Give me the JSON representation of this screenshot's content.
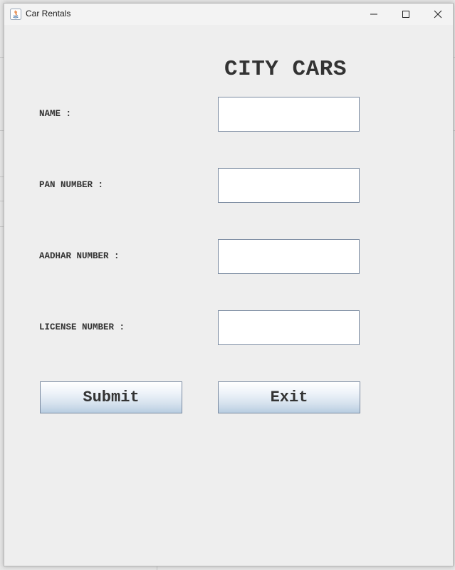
{
  "window": {
    "title": "Car Rentals"
  },
  "form": {
    "heading": "CITY CARS",
    "fields": [
      {
        "label": "NAME :",
        "value": ""
      },
      {
        "label": "PAN NUMBER :",
        "value": ""
      },
      {
        "label": "AADHAR NUMBER :",
        "value": ""
      },
      {
        "label": "LICENSE NUMBER :",
        "value": ""
      }
    ],
    "buttons": {
      "submit_label": "Submit",
      "exit_label": "Exit"
    }
  },
  "colors": {
    "window_bg": "#eeeeee",
    "text": "#333333",
    "input_border": "#7a8aa0",
    "button_gradient_bottom": "#b8cde1"
  }
}
